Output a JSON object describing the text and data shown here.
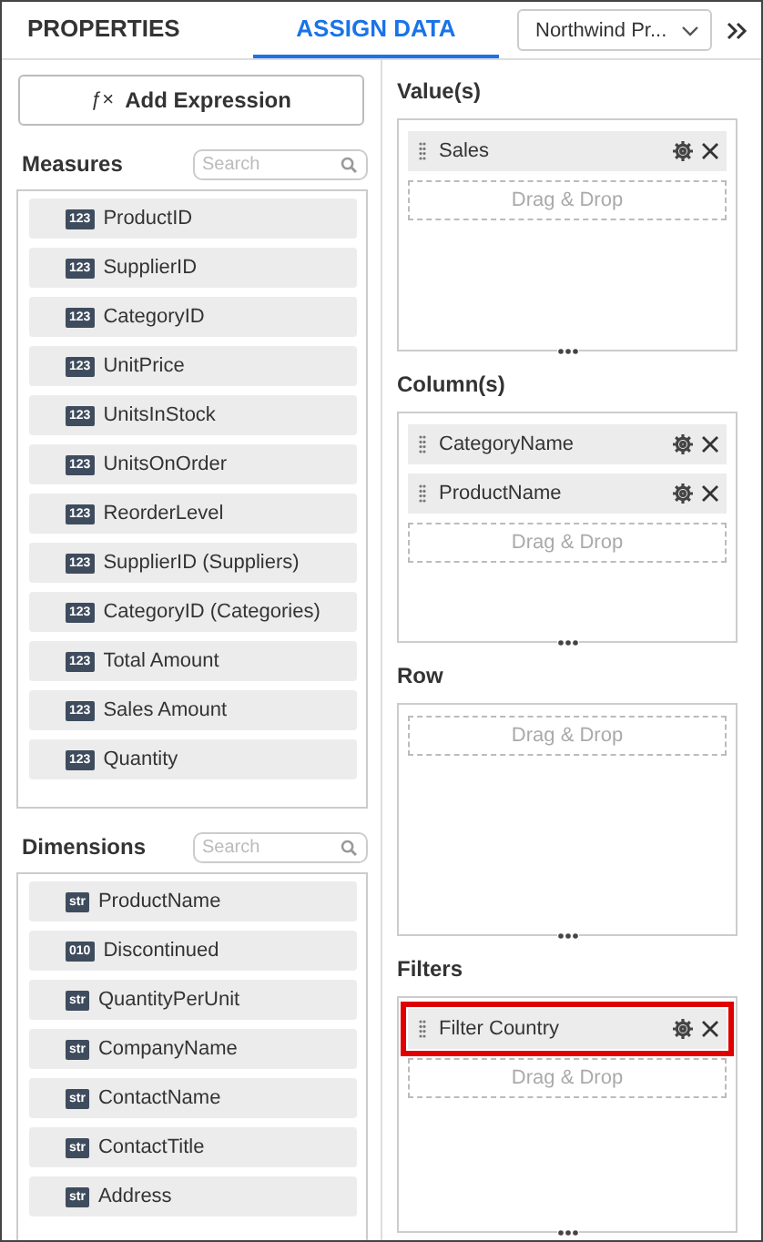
{
  "tabs": [
    {
      "label": "PROPERTIES",
      "selected": false
    },
    {
      "label": "ASSIGN DATA",
      "selected": true
    }
  ],
  "datasource": {
    "value": "Northwind Pr..."
  },
  "add_expression": {
    "icon": "ƒ×",
    "label": "Add Expression"
  },
  "field_groups": [
    {
      "title": "Measures",
      "search": {
        "placeholder": "Search"
      },
      "items": [
        {
          "badge": "123",
          "name": "ProductID"
        },
        {
          "badge": "123",
          "name": "SupplierID"
        },
        {
          "badge": "123",
          "name": "CategoryID"
        },
        {
          "badge": "123",
          "name": "UnitPrice"
        },
        {
          "badge": "123",
          "name": "UnitsInStock"
        },
        {
          "badge": "123",
          "name": "UnitsOnOrder"
        },
        {
          "badge": "123",
          "name": "ReorderLevel"
        },
        {
          "badge": "123",
          "name": "SupplierID (Suppliers)"
        },
        {
          "badge": "123",
          "name": "CategoryID (Categories)"
        },
        {
          "badge": "123",
          "name": "Total Amount"
        },
        {
          "badge": "123",
          "name": "Sales Amount"
        },
        {
          "badge": "123",
          "name": "Quantity"
        }
      ]
    },
    {
      "title": "Dimensions",
      "search": {
        "placeholder": "Search"
      },
      "items": [
        {
          "badge": "str",
          "name": "ProductName"
        },
        {
          "badge": "010",
          "name": "Discontinued"
        },
        {
          "badge": "str",
          "name": "QuantityPerUnit"
        },
        {
          "badge": "str",
          "name": "CompanyName"
        },
        {
          "badge": "str",
          "name": "ContactName"
        },
        {
          "badge": "str",
          "name": "ContactTitle"
        },
        {
          "badge": "str",
          "name": "Address"
        }
      ]
    }
  ],
  "sections": [
    {
      "title": "Value(s)",
      "items": [
        {
          "name": "Sales",
          "highlighted": false
        }
      ],
      "drop_hint": "Drag & Drop"
    },
    {
      "title": "Column(s)",
      "items": [
        {
          "name": "CategoryName",
          "highlighted": false
        },
        {
          "name": "ProductName",
          "highlighted": false
        }
      ],
      "drop_hint": "Drag & Drop"
    },
    {
      "title": "Row",
      "drop_hint": "Drag & Drop"
    },
    {
      "title": "Filters",
      "items": [
        {
          "name": "Filter Country",
          "highlighted": true
        }
      ],
      "drop_hint": "Drag & Drop"
    }
  ]
}
